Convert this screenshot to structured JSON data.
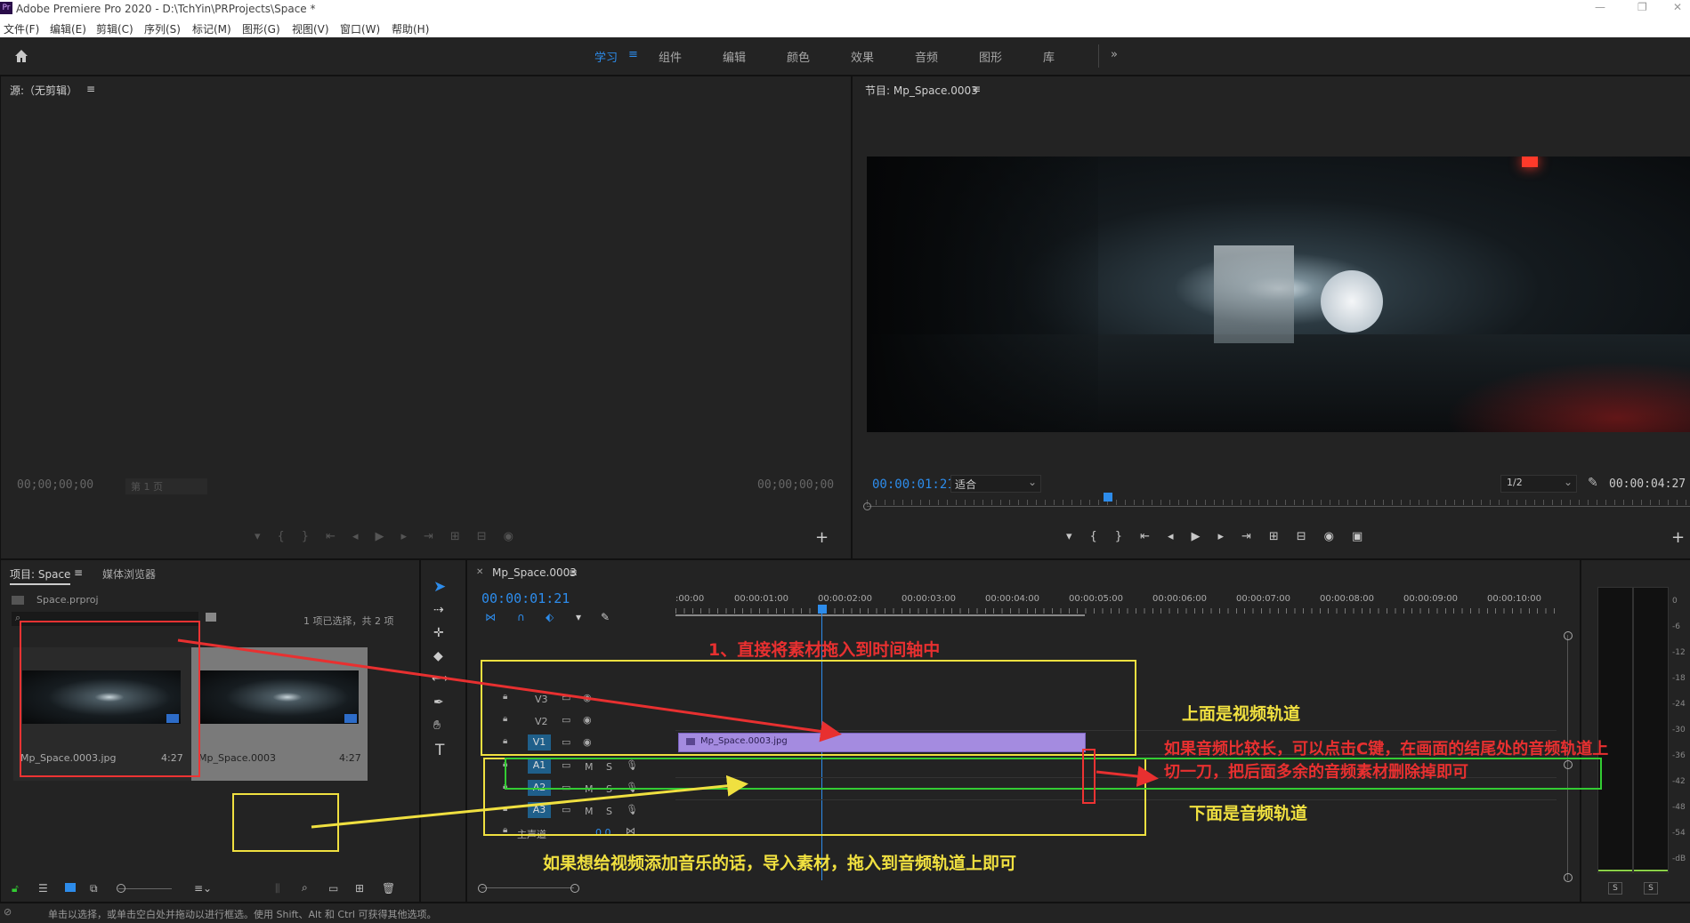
{
  "app": {
    "title": "Adobe Premiere Pro 2020 - D:\\TchYin\\PRProjects\\Space *",
    "icon": "Pr",
    "window_controls": {
      "minimize": "—",
      "restore": "❐",
      "close": "✕"
    }
  },
  "menu": [
    "文件(F)",
    "编辑(E)",
    "剪辑(C)",
    "序列(S)",
    "标记(M)",
    "图形(G)",
    "视图(V)",
    "窗口(W)",
    "帮助(H)"
  ],
  "workspaces": {
    "items": [
      "学习",
      "组件",
      "编辑",
      "颜色",
      "效果",
      "音频",
      "图形",
      "库"
    ],
    "active": "学习",
    "more": "»"
  },
  "source": {
    "title": "源:（无剪辑）",
    "timecode_left": "00;00;00;00",
    "page": "第 1 页",
    "timecode_right": "00;00;00;00"
  },
  "program": {
    "title": "节目: Mp_Space.0003",
    "timecode": "00:00:01:21",
    "fit": "适合",
    "resolution": "1/2",
    "duration": "00:00:04:27"
  },
  "project": {
    "tab_project": "项目: Space",
    "tab_media": "媒体浏览器",
    "file": "Space.prproj",
    "selection": "1 项已选择，共 2 项",
    "items": [
      {
        "name": "Mp_Space.0003.jpg",
        "duration": "4:27"
      },
      {
        "name": "Mp_Space.0003",
        "duration": "4:27"
      }
    ]
  },
  "timeline": {
    "tab": "Mp_Space.0003",
    "timecode": "00:00:01:21",
    "ruler": [
      ":00:00",
      "00:00:01:00",
      "00:00:02:00",
      "00:00:03:00",
      "00:00:04:00",
      "00:00:05:00",
      "00:00:06:00",
      "00:00:07:00",
      "00:00:08:00",
      "00:00:09:00",
      "00:00:10:00"
    ],
    "video_tracks": [
      "V3",
      "V2",
      "V1"
    ],
    "audio_tracks": [
      "A1",
      "A2",
      "A3"
    ],
    "master": "主声道",
    "master_value": "0.0",
    "clip_name": "Mp_Space.0003.jpg",
    "mute": "M",
    "solo": "S"
  },
  "meter": {
    "scale": [
      "0",
      "-6",
      "-12",
      "-18",
      "-24",
      "-30",
      "-36",
      "-42",
      "-48",
      "-54",
      "-dB"
    ],
    "solo": [
      "S",
      "S"
    ]
  },
  "annotations": {
    "step1": "1、直接将素材拖入到时间轴中",
    "video_tracks": "上面是视频轨道",
    "audio_tip_line1": "如果音频比较长，可以点击C键，在画面的结尾处的音频轨道上",
    "audio_tip_line2": "切一刀，把后面多余的音频素材删除掉即可",
    "audio_tracks": "下面是音频轨道",
    "add_music": "如果想给视频添加音乐的话，导入素材，拖入到音频轨道上即可"
  },
  "status": "单击以选择，或单击空白处并拖动以进行框选。使用 Shift、Alt 和 Ctrl 可获得其他选项。",
  "colors": {
    "accent": "#2d8ceb",
    "clip": "#a48be0",
    "annotation_red": "#e83030",
    "annotation_yellow": "#f0e040",
    "annotation_green": "#33cc44"
  }
}
